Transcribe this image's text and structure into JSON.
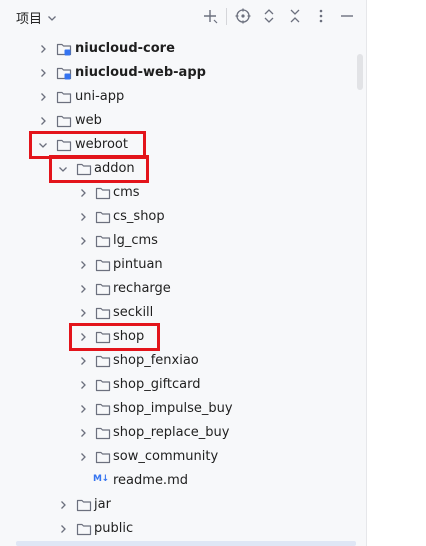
{
  "header": {
    "title": "项目",
    "toolbar_icons": [
      "add-icon",
      "locate-icon",
      "expand-all-icon",
      "collapse-all-icon",
      "more-icon",
      "minimize-icon"
    ]
  },
  "tree": [
    {
      "label": "niucloud-core",
      "depth": 0,
      "kind": "module",
      "bold": true,
      "expanded": false
    },
    {
      "label": "niucloud-web-app",
      "depth": 0,
      "kind": "module",
      "bold": true,
      "expanded": false
    },
    {
      "label": "uni-app",
      "depth": 0,
      "kind": "folder",
      "bold": false,
      "expanded": false
    },
    {
      "label": "web",
      "depth": 0,
      "kind": "folder",
      "bold": false,
      "expanded": false
    },
    {
      "label": "webroot",
      "depth": 0,
      "kind": "folder",
      "bold": false,
      "expanded": true,
      "highlighted": true
    },
    {
      "label": "addon",
      "depth": 1,
      "kind": "folder",
      "bold": false,
      "expanded": true,
      "highlighted": true
    },
    {
      "label": "cms",
      "depth": 2,
      "kind": "folder",
      "bold": false,
      "expanded": false
    },
    {
      "label": "cs_shop",
      "depth": 2,
      "kind": "folder",
      "bold": false,
      "expanded": false
    },
    {
      "label": "lg_cms",
      "depth": 2,
      "kind": "folder",
      "bold": false,
      "expanded": false
    },
    {
      "label": "pintuan",
      "depth": 2,
      "kind": "folder",
      "bold": false,
      "expanded": false
    },
    {
      "label": "recharge",
      "depth": 2,
      "kind": "folder",
      "bold": false,
      "expanded": false
    },
    {
      "label": "seckill",
      "depth": 2,
      "kind": "folder",
      "bold": false,
      "expanded": false
    },
    {
      "label": "shop",
      "depth": 2,
      "kind": "folder",
      "bold": false,
      "expanded": false,
      "highlighted": true
    },
    {
      "label": "shop_fenxiao",
      "depth": 2,
      "kind": "folder",
      "bold": false,
      "expanded": false
    },
    {
      "label": "shop_giftcard",
      "depth": 2,
      "kind": "folder",
      "bold": false,
      "expanded": false
    },
    {
      "label": "shop_impulse_buy",
      "depth": 2,
      "kind": "folder",
      "bold": false,
      "expanded": false
    },
    {
      "label": "shop_replace_buy",
      "depth": 2,
      "kind": "folder",
      "bold": false,
      "expanded": false
    },
    {
      "label": "sow_community",
      "depth": 2,
      "kind": "folder",
      "bold": false,
      "expanded": false
    },
    {
      "label": "readme.md",
      "depth": 2,
      "kind": "markdown",
      "bold": false,
      "icon_text": "M↓"
    },
    {
      "label": "jar",
      "depth": 1,
      "kind": "folder",
      "bold": false,
      "expanded": false
    },
    {
      "label": "public",
      "depth": 1,
      "kind": "folder",
      "bold": false,
      "expanded": false
    }
  ],
  "colors": {
    "highlight_border": "#e3141b",
    "module_badge": "#3574f0",
    "folder_stroke": "#6c707e"
  }
}
